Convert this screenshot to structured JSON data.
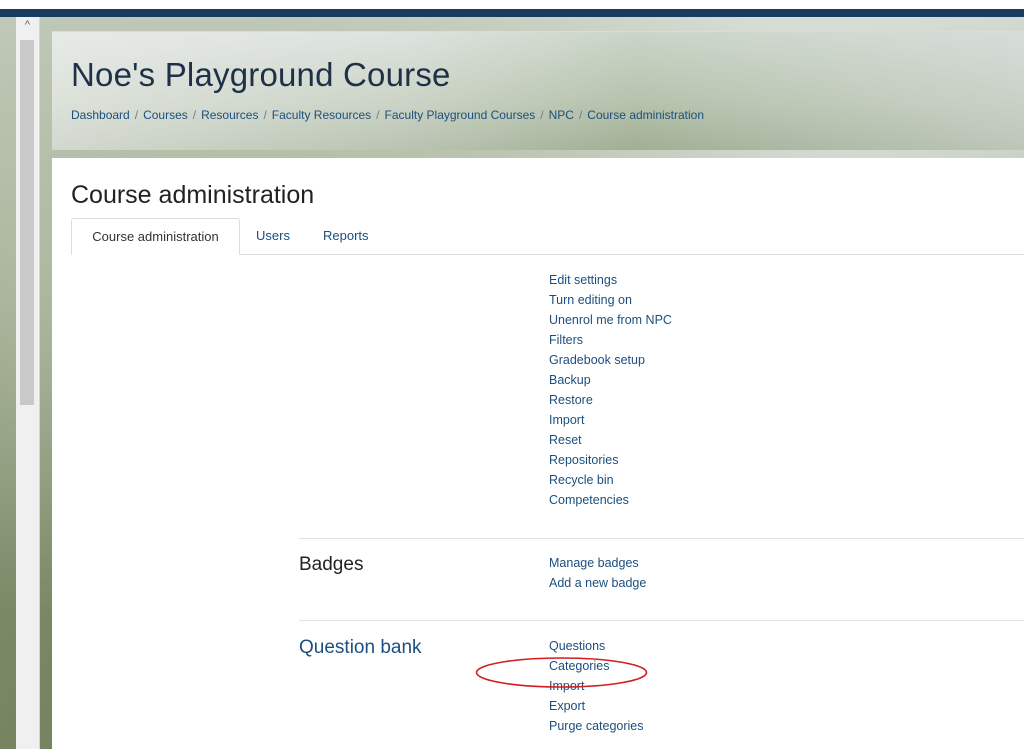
{
  "header": {
    "course_title": "Noe's Playground Course",
    "breadcrumb": [
      "Dashboard",
      "Courses",
      "Resources",
      "Faculty Resources",
      "Faculty Playground Courses",
      "NPC",
      "Course administration"
    ]
  },
  "main": {
    "page_title": "Course administration",
    "tabs": [
      {
        "label": "Course administration",
        "active": true
      },
      {
        "label": "Users",
        "active": false
      },
      {
        "label": "Reports",
        "active": false
      }
    ]
  },
  "sections": {
    "course": {
      "items": [
        "Edit settings",
        "Turn editing on",
        "Unenrol me from NPC",
        "Filters",
        "Gradebook setup",
        "Backup",
        "Restore",
        "Import",
        "Reset",
        "Repositories",
        "Recycle bin",
        "Competencies"
      ]
    },
    "badges": {
      "title": "Badges",
      "items": [
        "Manage badges",
        "Add a new badge"
      ]
    },
    "question_bank": {
      "title": "Question bank",
      "items": [
        "Questions",
        "Categories",
        "Import",
        "Export",
        "Purge categories"
      ]
    }
  },
  "colors": {
    "link": "#1c4f7f",
    "top_bar": "#1a3d5d",
    "highlight_annotation": "#d11f1f"
  }
}
